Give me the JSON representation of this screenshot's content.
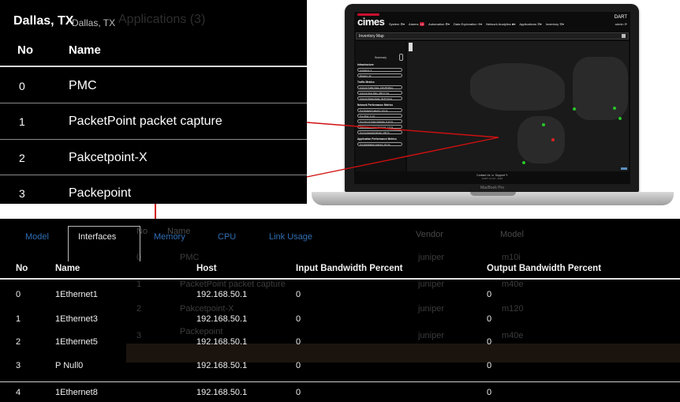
{
  "laptop": {
    "app": {
      "logo": "cimes",
      "product": "DART",
      "user": "admin ⟳",
      "nav": [
        {
          "label": "System ⚙▾"
        },
        {
          "label": "Alarms",
          "badge": "10"
        },
        {
          "label": "Automation ⚙▾"
        },
        {
          "label": "Data Exploration ⟲▾"
        },
        {
          "label": "Network Analytics ♣▾"
        },
        {
          "label": "Applications ☰▾"
        },
        {
          "label": "Inventory ☰▾"
        }
      ],
      "page_title": "Inventory Map",
      "sidebar": {
        "summary_label": "Summary",
        "infrastructure_heading": "Infrastructure",
        "locations": "Locations: 3",
        "routers": "Routers: 14",
        "traffic_heading": "Traffic Metrics",
        "traffic_rate": "Current Traffic Rate: 219.28 Mbps",
        "flow_rate": "Current Flow Rate: 368.17 fps",
        "packet_rate": "Current Packet Rate: 39.87 Kpps",
        "npm_heading": "Network Performance Metrics",
        "network_latency": "Top Network Latency: 13 ms",
        "top_jitter": "Top Jitter: 4 ms",
        "out_of_order": "Top Out of Order Packets: 0.13 %",
        "retransmitted": "Top Retransmitted Packets: 1.9 %",
        "congested": "Top Congested Router: 100 %",
        "apm_heading": "Application Performance Metrics",
        "app_latency": "Top Application Latency: 22 ms"
      },
      "footer": {
        "links": "Contact Us ☏     Support ✎",
        "version": "DART v2.0.8 - 2018"
      }
    },
    "model": "MacBook Pro"
  },
  "zoom_panel": {
    "ghost_text": "Applications (3)",
    "city": "Dallas, TX",
    "city_sub": "Dallas, TX",
    "columns": {
      "no": "No",
      "name": "Name"
    },
    "rows": [
      {
        "no": "0",
        "name": "PMC"
      },
      {
        "no": "1",
        "name": "PacketPoint packet capture"
      },
      {
        "no": "2",
        "name": "Pakcetpoint-X"
      },
      {
        "no": "3",
        "name": "Packepoint"
      }
    ]
  },
  "interfaces_panel": {
    "tabs": [
      {
        "label": "Model",
        "active": false
      },
      {
        "label": "Interfaces",
        "active": true
      },
      {
        "label": "Memory",
        "active": false
      },
      {
        "label": "CPU",
        "active": false
      },
      {
        "label": "Link Usage",
        "active": false
      }
    ],
    "columns": {
      "no": "No",
      "name": "Name",
      "host": "Host",
      "input": "Input Bandwidth Percent",
      "output": "Output Bandwidth Percent"
    },
    "rows": [
      {
        "no": "0",
        "name": "1Ethernet1",
        "host": "192.168.50.1",
        "input": "0",
        "output": "0"
      },
      {
        "no": "1",
        "name": "1Ethernet3",
        "host": "192.168.50.1",
        "input": "0",
        "output": "0"
      },
      {
        "no": "2",
        "name": "1Ethernet5",
        "host": "192.168.50.1",
        "input": "0",
        "output": "0"
      },
      {
        "no": "3",
        "name": "P Null0",
        "host": "192.168.50.1",
        "input": "0",
        "output": "0"
      },
      {
        "no": "4",
        "name": "1Ethernet8",
        "host": "192.168.50.1",
        "input": "0",
        "output": "0"
      }
    ],
    "ghost_layer": {
      "col_no": "No",
      "col_name": "Name",
      "col_vendor": "Vendor",
      "col_model": "Model",
      "rows": [
        {
          "no": "0",
          "name": "PMC",
          "vendor": "juniper",
          "model": "m10i"
        },
        {
          "no": "1",
          "name": "PacketPoint packet capture",
          "vendor": "juniper",
          "model": "m40e"
        },
        {
          "no": "2",
          "name": "Pakcetpoint-X",
          "vendor": "juniper",
          "model": "m120"
        },
        {
          "no": "3",
          "name": "Packepoint",
          "vendor": "juniper",
          "model": "m40e"
        }
      ]
    }
  },
  "colors": {
    "connector": "#d01010",
    "tab_link": "#2f6fb3",
    "brand_red": "#c8102e",
    "map_green": "#28c428"
  }
}
